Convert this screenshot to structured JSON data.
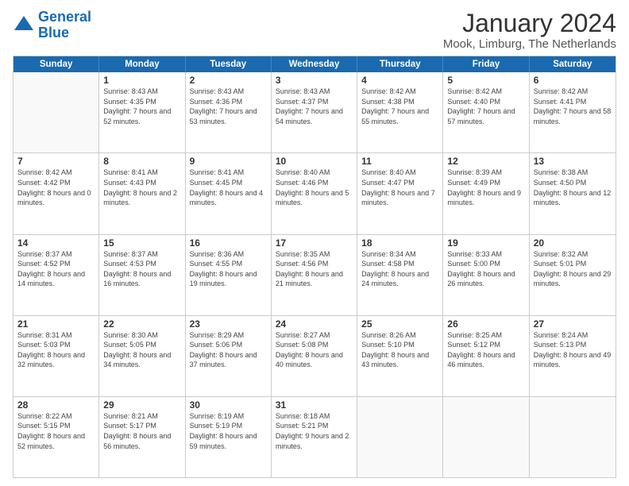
{
  "logo": {
    "line1": "General",
    "line2": "Blue"
  },
  "title": "January 2024",
  "subtitle": "Mook, Limburg, The Netherlands",
  "headers": [
    "Sunday",
    "Monday",
    "Tuesday",
    "Wednesday",
    "Thursday",
    "Friday",
    "Saturday"
  ],
  "weeks": [
    [
      {
        "day": "",
        "sunrise": "",
        "sunset": "",
        "daylight": ""
      },
      {
        "day": "1",
        "sunrise": "Sunrise: 8:43 AM",
        "sunset": "Sunset: 4:35 PM",
        "daylight": "Daylight: 7 hours and 52 minutes."
      },
      {
        "day": "2",
        "sunrise": "Sunrise: 8:43 AM",
        "sunset": "Sunset: 4:36 PM",
        "daylight": "Daylight: 7 hours and 53 minutes."
      },
      {
        "day": "3",
        "sunrise": "Sunrise: 8:43 AM",
        "sunset": "Sunset: 4:37 PM",
        "daylight": "Daylight: 7 hours and 54 minutes."
      },
      {
        "day": "4",
        "sunrise": "Sunrise: 8:42 AM",
        "sunset": "Sunset: 4:38 PM",
        "daylight": "Daylight: 7 hours and 55 minutes."
      },
      {
        "day": "5",
        "sunrise": "Sunrise: 8:42 AM",
        "sunset": "Sunset: 4:40 PM",
        "daylight": "Daylight: 7 hours and 57 minutes."
      },
      {
        "day": "6",
        "sunrise": "Sunrise: 8:42 AM",
        "sunset": "Sunset: 4:41 PM",
        "daylight": "Daylight: 7 hours and 58 minutes."
      }
    ],
    [
      {
        "day": "7",
        "sunrise": "Sunrise: 8:42 AM",
        "sunset": "Sunset: 4:42 PM",
        "daylight": "Daylight: 8 hours and 0 minutes."
      },
      {
        "day": "8",
        "sunrise": "Sunrise: 8:41 AM",
        "sunset": "Sunset: 4:43 PM",
        "daylight": "Daylight: 8 hours and 2 minutes."
      },
      {
        "day": "9",
        "sunrise": "Sunrise: 8:41 AM",
        "sunset": "Sunset: 4:45 PM",
        "daylight": "Daylight: 8 hours and 4 minutes."
      },
      {
        "day": "10",
        "sunrise": "Sunrise: 8:40 AM",
        "sunset": "Sunset: 4:46 PM",
        "daylight": "Daylight: 8 hours and 5 minutes."
      },
      {
        "day": "11",
        "sunrise": "Sunrise: 8:40 AM",
        "sunset": "Sunset: 4:47 PM",
        "daylight": "Daylight: 8 hours and 7 minutes."
      },
      {
        "day": "12",
        "sunrise": "Sunrise: 8:39 AM",
        "sunset": "Sunset: 4:49 PM",
        "daylight": "Daylight: 8 hours and 9 minutes."
      },
      {
        "day": "13",
        "sunrise": "Sunrise: 8:38 AM",
        "sunset": "Sunset: 4:50 PM",
        "daylight": "Daylight: 8 hours and 12 minutes."
      }
    ],
    [
      {
        "day": "14",
        "sunrise": "Sunrise: 8:37 AM",
        "sunset": "Sunset: 4:52 PM",
        "daylight": "Daylight: 8 hours and 14 minutes."
      },
      {
        "day": "15",
        "sunrise": "Sunrise: 8:37 AM",
        "sunset": "Sunset: 4:53 PM",
        "daylight": "Daylight: 8 hours and 16 minutes."
      },
      {
        "day": "16",
        "sunrise": "Sunrise: 8:36 AM",
        "sunset": "Sunset: 4:55 PM",
        "daylight": "Daylight: 8 hours and 19 minutes."
      },
      {
        "day": "17",
        "sunrise": "Sunrise: 8:35 AM",
        "sunset": "Sunset: 4:56 PM",
        "daylight": "Daylight: 8 hours and 21 minutes."
      },
      {
        "day": "18",
        "sunrise": "Sunrise: 8:34 AM",
        "sunset": "Sunset: 4:58 PM",
        "daylight": "Daylight: 8 hours and 24 minutes."
      },
      {
        "day": "19",
        "sunrise": "Sunrise: 8:33 AM",
        "sunset": "Sunset: 5:00 PM",
        "daylight": "Daylight: 8 hours and 26 minutes."
      },
      {
        "day": "20",
        "sunrise": "Sunrise: 8:32 AM",
        "sunset": "Sunset: 5:01 PM",
        "daylight": "Daylight: 8 hours and 29 minutes."
      }
    ],
    [
      {
        "day": "21",
        "sunrise": "Sunrise: 8:31 AM",
        "sunset": "Sunset: 5:03 PM",
        "daylight": "Daylight: 8 hours and 32 minutes."
      },
      {
        "day": "22",
        "sunrise": "Sunrise: 8:30 AM",
        "sunset": "Sunset: 5:05 PM",
        "daylight": "Daylight: 8 hours and 34 minutes."
      },
      {
        "day": "23",
        "sunrise": "Sunrise: 8:29 AM",
        "sunset": "Sunset: 5:06 PM",
        "daylight": "Daylight: 8 hours and 37 minutes."
      },
      {
        "day": "24",
        "sunrise": "Sunrise: 8:27 AM",
        "sunset": "Sunset: 5:08 PM",
        "daylight": "Daylight: 8 hours and 40 minutes."
      },
      {
        "day": "25",
        "sunrise": "Sunrise: 8:26 AM",
        "sunset": "Sunset: 5:10 PM",
        "daylight": "Daylight: 8 hours and 43 minutes."
      },
      {
        "day": "26",
        "sunrise": "Sunrise: 8:25 AM",
        "sunset": "Sunset: 5:12 PM",
        "daylight": "Daylight: 8 hours and 46 minutes."
      },
      {
        "day": "27",
        "sunrise": "Sunrise: 8:24 AM",
        "sunset": "Sunset: 5:13 PM",
        "daylight": "Daylight: 8 hours and 49 minutes."
      }
    ],
    [
      {
        "day": "28",
        "sunrise": "Sunrise: 8:22 AM",
        "sunset": "Sunset: 5:15 PM",
        "daylight": "Daylight: 8 hours and 52 minutes."
      },
      {
        "day": "29",
        "sunrise": "Sunrise: 8:21 AM",
        "sunset": "Sunset: 5:17 PM",
        "daylight": "Daylight: 8 hours and 56 minutes."
      },
      {
        "day": "30",
        "sunrise": "Sunrise: 8:19 AM",
        "sunset": "Sunset: 5:19 PM",
        "daylight": "Daylight: 8 hours and 59 minutes."
      },
      {
        "day": "31",
        "sunrise": "Sunrise: 8:18 AM",
        "sunset": "Sunset: 5:21 PM",
        "daylight": "Daylight: 9 hours and 2 minutes."
      },
      {
        "day": "",
        "sunrise": "",
        "sunset": "",
        "daylight": ""
      },
      {
        "day": "",
        "sunrise": "",
        "sunset": "",
        "daylight": ""
      },
      {
        "day": "",
        "sunrise": "",
        "sunset": "",
        "daylight": ""
      }
    ]
  ]
}
